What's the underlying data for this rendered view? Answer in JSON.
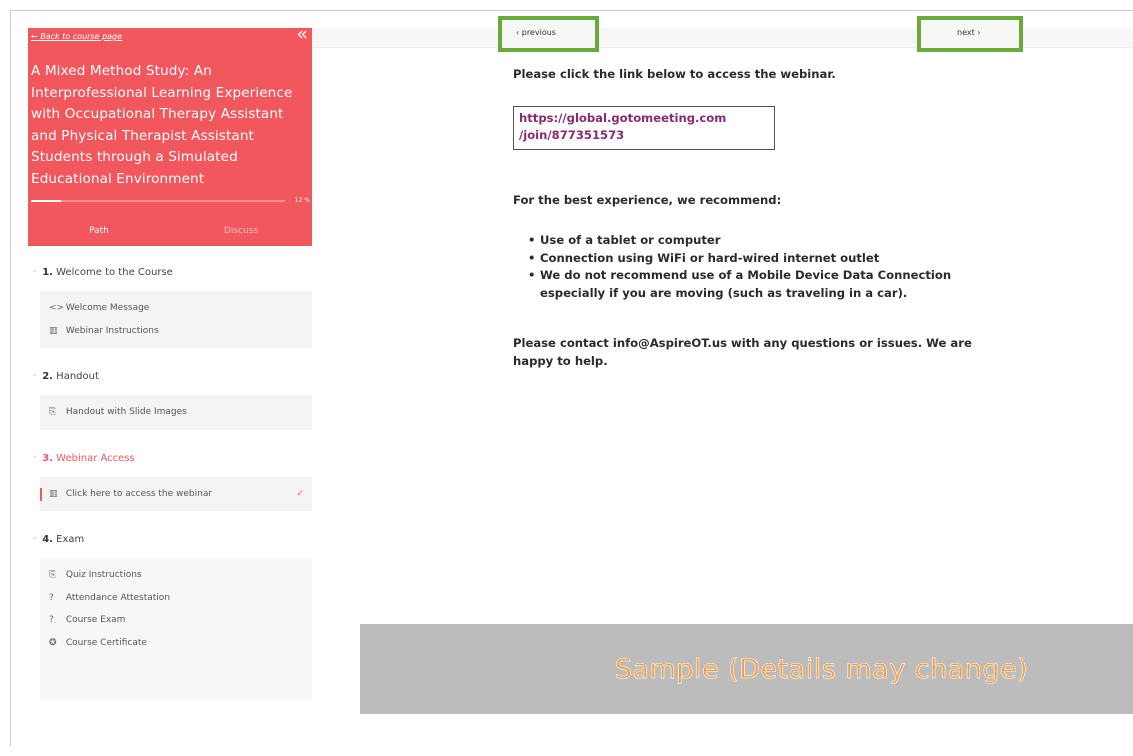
{
  "sidebar": {
    "back_link": "← Back to course page",
    "collapse_icon": "double-chevron-left-icon",
    "course_title": "A Mixed Method Study: An Interprofessional Learning Experience with Occupational Therapy Assistant and Physical Therapist Assistant Students through a Simulated Educational Environment",
    "progress_percent_label": "12 %",
    "progress_value": 0.12,
    "tabs": [
      {
        "label": "Path",
        "active": true
      },
      {
        "label": "Discuss",
        "active": false
      }
    ],
    "sections": [
      {
        "num": "1.",
        "title": "Welcome to the Course",
        "lessons": [
          {
            "icon": "code-icon",
            "label": "Welcome Message"
          },
          {
            "icon": "book-icon",
            "label": "Webinar Instructions"
          }
        ]
      },
      {
        "num": "2.",
        "title": "Handout",
        "lessons": [
          {
            "icon": "pdf-icon",
            "label": "Handout with Slide Images"
          }
        ]
      },
      {
        "num": "3.",
        "title": "Webinar Access",
        "lessons": [
          {
            "icon": "book-icon",
            "label": "Click here to access the webinar",
            "completed_mark": "✓"
          }
        ]
      },
      {
        "num": "4.",
        "title": "Exam",
        "lessons": [
          {
            "icon": "pdf-icon",
            "label": "Quiz Instructions"
          },
          {
            "icon": "question-circle-icon",
            "label": "Attendance Attestation"
          },
          {
            "icon": "question-circle-icon",
            "label": "Course Exam"
          },
          {
            "icon": "certificate-icon",
            "label": "Course Certificate"
          }
        ]
      }
    ]
  },
  "nav": {
    "previous_label": "‹ previous",
    "next_label": "next ›"
  },
  "content": {
    "intro": "Please click the link below to access the webinar.",
    "link_line1": "https://global.gotomeeting.com",
    "link_line2": "/join/877351573",
    "recommend_heading": "For the best experience, we recommend:",
    "bullets": [
      "Use of a tablet or computer",
      "Connection using WiFi or hard-wired internet outlet",
      "We do not recommend use of a Mobile Device Data Connection especially if you are moving (such as traveling in a car)."
    ],
    "contact": "Please contact info@AspireOT.us with any questions or issues. We are happy to help."
  },
  "banner": {
    "text": "Sample (Details may change)"
  },
  "colors": {
    "accent": "#f2575d",
    "highlight_border": "#6aaa3a",
    "link": "#8a2a6e",
    "banner_text": "#f49a3c"
  }
}
